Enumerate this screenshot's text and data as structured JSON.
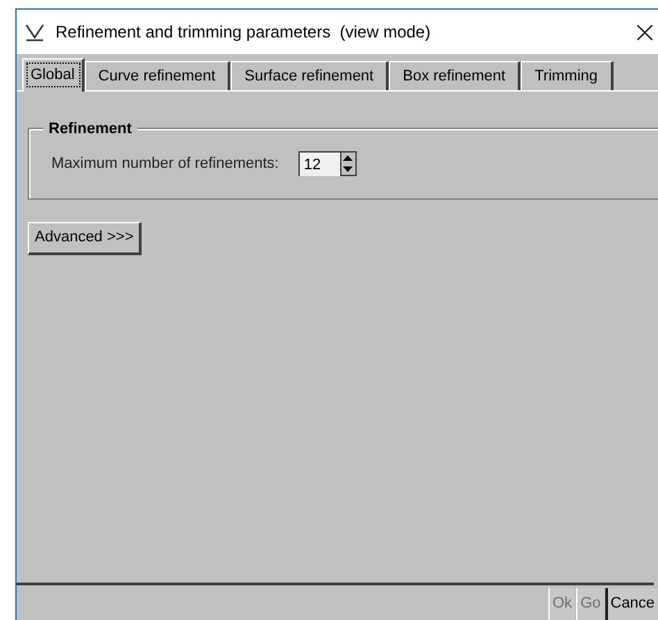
{
  "window": {
    "title": "Refinement and trimming parameters  (view mode)"
  },
  "tabs": [
    {
      "label": "Global",
      "selected": true
    },
    {
      "label": "Curve refinement",
      "selected": false
    },
    {
      "label": "Surface refinement",
      "selected": false
    },
    {
      "label": "Box refinement",
      "selected": false
    },
    {
      "label": "Trimming",
      "selected": false
    }
  ],
  "group": {
    "title": "Refinement",
    "field_label": "Maximum number of refinements:",
    "value": "12"
  },
  "advanced_button": "Advanced >>>",
  "buttons": [
    {
      "label": "Ok",
      "disabled": true
    },
    {
      "label": "Go",
      "disabled": true
    },
    {
      "label": "Cance",
      "disabled": false
    }
  ]
}
